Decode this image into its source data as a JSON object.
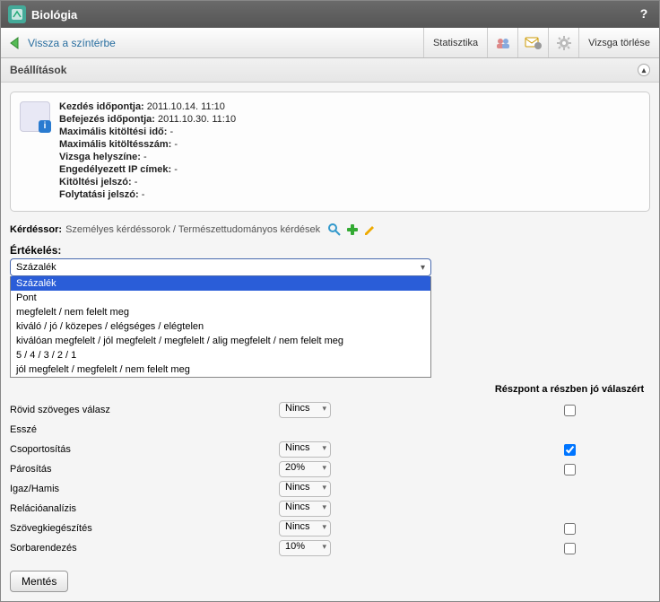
{
  "titlebar": {
    "title": "Biológia",
    "help": "?"
  },
  "toolbar": {
    "back": "Vissza a színtérbe",
    "stats": "Statisztika",
    "delexam": "Vizsga törlése"
  },
  "section": {
    "title": "Beállítások"
  },
  "info": {
    "l1a": "Kezdés időpontja:",
    "l1b": "2011.10.14. 11:10",
    "l2a": "Befejezés időpontja:",
    "l2b": "2011.10.30. 11:10",
    "l3a": "Maximális kitöltési idő:",
    "l3b": "-",
    "l4a": "Maximális kitöltésszám:",
    "l4b": "-",
    "l5a": "Vizsga helyszíne:",
    "l5b": "-",
    "l6a": "Engedélyezett IP címek:",
    "l6b": "-",
    "l7a": "Kitöltési jelszó:",
    "l7b": "-",
    "l8a": "Folytatási jelszó:",
    "l8b": "-"
  },
  "qrow": {
    "label": "Kérdéssor:",
    "text": "Személyes kérdéssorok / Természettudományos kérdések"
  },
  "eval": {
    "label": "Értékelés:",
    "value": "Százalék",
    "opts": [
      "Százalék",
      "Pont",
      "megfelelt / nem felelt meg",
      "kiváló / jó / közepes / elégséges / elégtelen",
      "kiválóan megfelelt / jól megfelelt / megfelelt / alig megfelelt / nem felelt meg",
      "5 / 4 / 3 / 2 / 1",
      "jól megfelelt / megfelelt / nem felelt meg"
    ]
  },
  "gridheader": "Részpont a részben jó válaszért",
  "rows": [
    {
      "name": "Rövid szöveges válasz",
      "sel": "Nincs",
      "chk": false
    },
    {
      "name": "Esszé",
      "sel": "",
      "chk": null
    },
    {
      "name": "Csoportosítás",
      "sel": "Nincs",
      "chk": true
    },
    {
      "name": "Párosítás",
      "sel": "20%",
      "chk": false
    },
    {
      "name": "Igaz/Hamis",
      "sel": "Nincs",
      "chk": null
    },
    {
      "name": "Relációanalízis",
      "sel": "Nincs",
      "chk": null
    },
    {
      "name": "Szövegkiegészítés",
      "sel": "Nincs",
      "chk": false
    },
    {
      "name": "Sorbarendezés",
      "sel": "10%",
      "chk": false
    }
  ],
  "save": "Mentés"
}
